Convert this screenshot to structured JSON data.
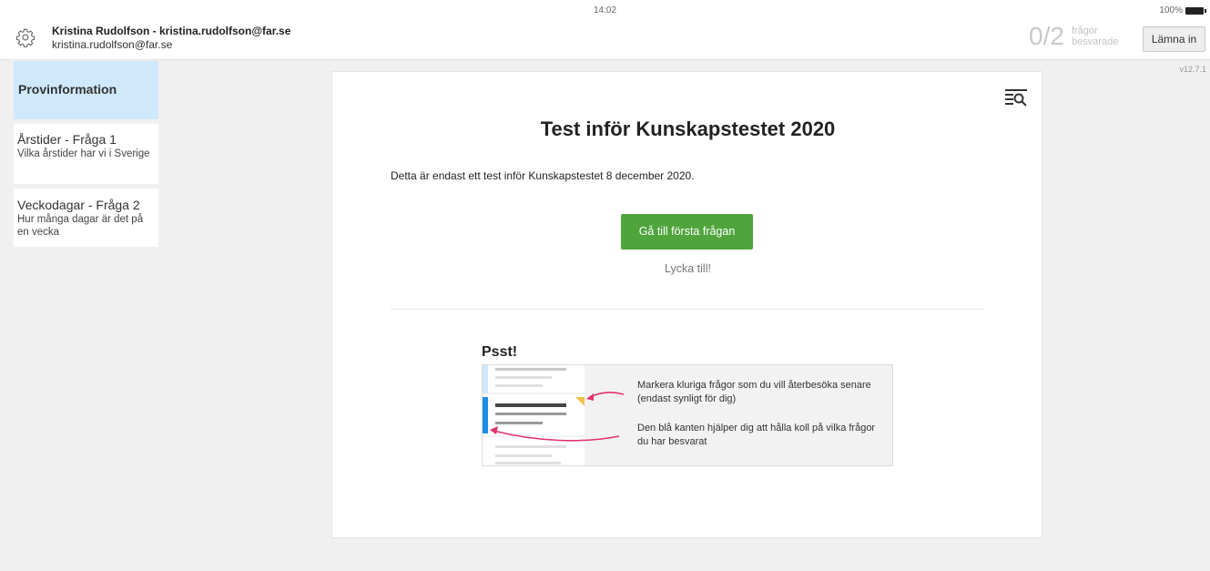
{
  "header": {
    "user_name": "Kristina Rudolfson - kristina.rudolfson@far.se",
    "user_email": "kristina.rudolfson@far.se",
    "time": "14:02",
    "battery_percent": "100%",
    "answered_count": "0/2",
    "answered_label_line1": "frågor",
    "answered_label_line2": "besvarade",
    "submit_label": "Lämna in",
    "version": "v12.7.1"
  },
  "sidebar": {
    "heading": "Provinformation",
    "items": [
      {
        "title": "Årstider - Fråga 1",
        "subtitle": "Vilka årstider har vi i Sverige"
      },
      {
        "title": "Veckodagar - Fråga 2",
        "subtitle": "Hur många dagar är det på en vecka"
      }
    ]
  },
  "main": {
    "title": "Test inför Kunskapstestet 2020",
    "intro": "Detta är endast ett test inför Kunskapstestet 8 december 2020.",
    "start_button": "Gå till första frågan",
    "good_luck": "Lycka till!",
    "psst_title": "Psst!",
    "tip_mark": "Markera kluriga frågor som du vill återbesöka senare (endast synligt för dig)",
    "tip_blue_edge": "Den blå kanten hjälper dig att hålla koll på vilka frågor du har besvarat"
  },
  "colors": {
    "accent_green": "#4fa43b",
    "sidebar_active": "#cfe8fb",
    "answered_blue": "#1d8ee6",
    "arrow_pink": "#e0336c",
    "flag_yellow": "#f0c24b"
  },
  "icons": {
    "settings": "gear-icon",
    "filter": "filter-search-icon",
    "battery": "battery-icon"
  }
}
